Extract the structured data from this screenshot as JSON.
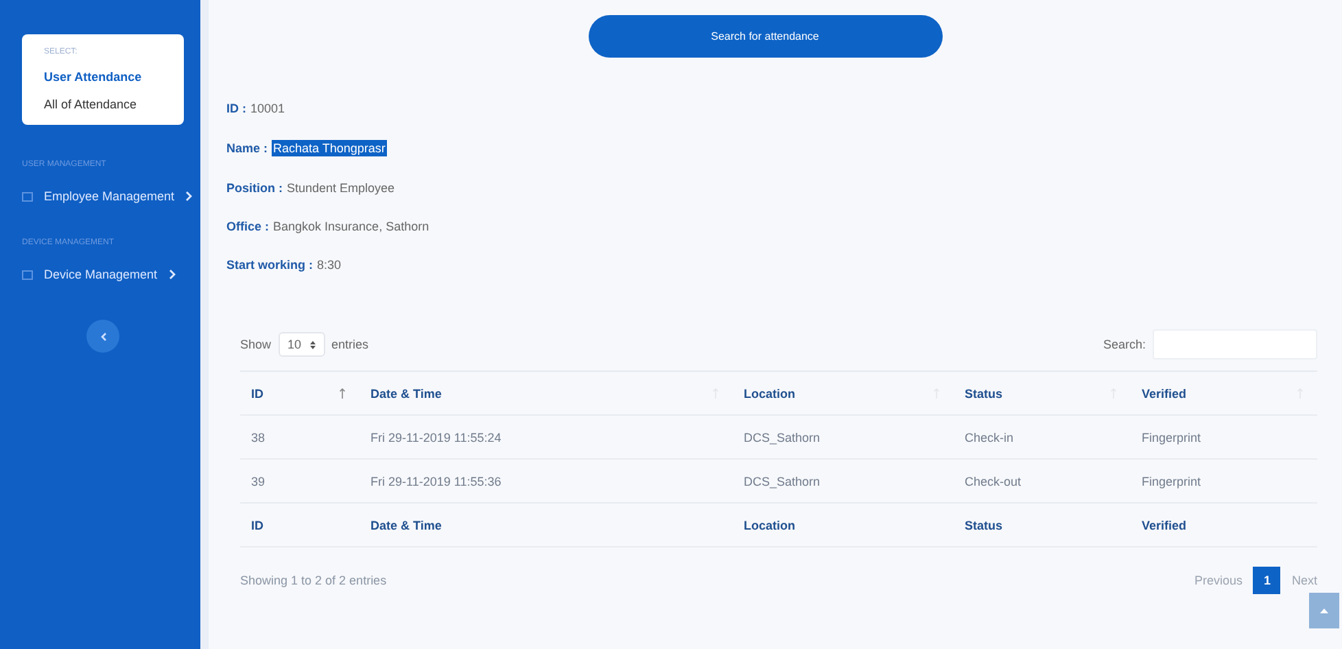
{
  "sidebar": {
    "select_label": "SELECT:",
    "select_items": [
      {
        "label": "User Attendance",
        "selected": true
      },
      {
        "label": "All of Attendance",
        "selected": false
      }
    ],
    "sections": [
      {
        "heading": "USER MANAGEMENT",
        "items": [
          {
            "label": "Employee Management"
          }
        ]
      },
      {
        "heading": "DEVICE MANAGEMENT",
        "items": [
          {
            "label": "Device Management"
          }
        ]
      }
    ]
  },
  "search_button": "Search for attendance",
  "details": [
    {
      "label": "ID :",
      "value": "10001",
      "highlighted": false
    },
    {
      "label": "Name :",
      "value": "Rachata Thongprasr",
      "highlighted": true
    },
    {
      "label": "Position :",
      "value": "Stundent Employee",
      "highlighted": false
    },
    {
      "label": "Office :",
      "value": "Bangkok Insurance, Sathorn",
      "highlighted": false
    },
    {
      "label": "Start working :",
      "value": "8:30",
      "highlighted": false
    }
  ],
  "table": {
    "show_label": "Show",
    "page_size": "10",
    "entries_label": "entries",
    "search_label": "Search:",
    "columns": [
      "ID",
      "Date & Time",
      "Location",
      "Status",
      "Verified"
    ],
    "rows": [
      [
        "38",
        "Fri 29-11-2019 11:55:24",
        "DCS_Sathorn",
        "Check-in",
        "Fingerprint"
      ],
      [
        "39",
        "Fri 29-11-2019 11:55:36",
        "DCS_Sathorn",
        "Check-out",
        "Fingerprint"
      ]
    ],
    "footer_columns": [
      "ID",
      "Date & Time",
      "Location",
      "Status",
      "Verified"
    ],
    "info": "Showing 1 to 2 of 2 entries",
    "pagination": {
      "previous": "Previous",
      "pages": [
        {
          "label": "1",
          "selected": true
        }
      ],
      "next": "Next"
    }
  }
}
